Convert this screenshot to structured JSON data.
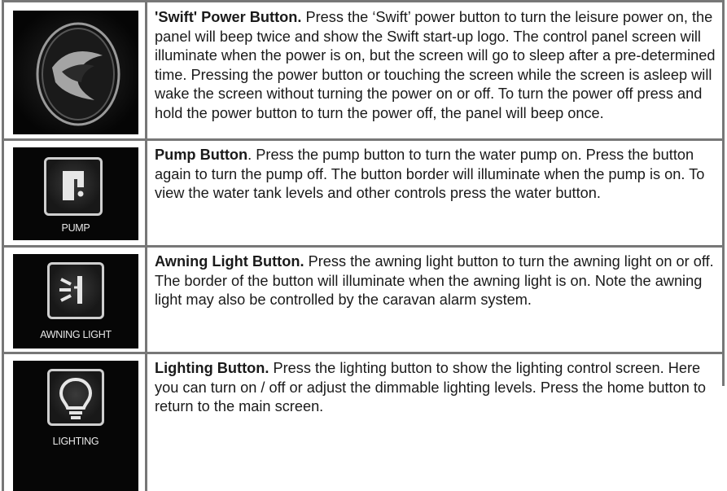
{
  "rows": [
    {
      "title": "'Swift' Power Button.",
      "body": " Press the ‘Swift’ power button to turn the leisure power on, the panel will beep twice and show the Swift start-up logo. The control panel screen will illuminate when the power is on, but the screen will go to sleep after a pre-determined time.  Pressing the power button or touching the screen while the screen is asleep will wake the screen without turning the power on or off.  To turn the power off press and hold the power button to turn the power off, the panel will beep once.",
      "icon": "swift-logo-icon"
    },
    {
      "title": "Pump Button",
      "body": ". Press the pump button to turn the water pump on.  Press the button again to turn the pump off.  The button border will illuminate when the pump is on.  To view the water tank levels and other controls press the water button.",
      "icon": "tap-icon",
      "caption": "PUMP"
    },
    {
      "title": "Awning Light Button.",
      "body": " Press the awning light button to turn the awning light on or off. The border of the button will illuminate when the awning light is on. Note the awning light may also be controlled by the caravan alarm system.",
      "icon": "wall-lamp-icon",
      "caption": "AWNING LIGHT"
    },
    {
      "title": "Lighting Button.",
      "body": " Press the lighting button to show the lighting control screen.  Here you can turn on / off or adjust the dimmable lighting levels. Press the home button to return to the main screen.",
      "icon": "light-bulb-icon",
      "caption": "LIGHTING"
    }
  ]
}
